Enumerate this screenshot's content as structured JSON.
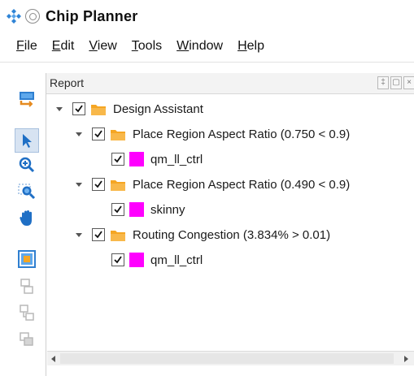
{
  "window": {
    "title": "Chip Planner"
  },
  "menu": [
    {
      "mnemonic": "F",
      "rest": "ile"
    },
    {
      "mnemonic": "E",
      "rest": "dit"
    },
    {
      "mnemonic": "V",
      "rest": "iew"
    },
    {
      "mnemonic": "T",
      "rest": "ools"
    },
    {
      "mnemonic": "W",
      "rest": "indow"
    },
    {
      "mnemonic": "H",
      "rest": "elp"
    }
  ],
  "toolbar": {
    "tools": [
      {
        "icon": "floorplan-icon"
      },
      {
        "icon": "selection-tool-icon"
      },
      {
        "icon": "zoom-in-icon"
      },
      {
        "icon": "zoom-area-icon"
      },
      {
        "icon": "hand-tool-icon"
      },
      {
        "icon": "region-tool-icon"
      },
      {
        "icon": "disabled-tool-icon"
      },
      {
        "icon": "disabled-tool-icon"
      },
      {
        "icon": "disabled-tool-icon"
      }
    ]
  },
  "panel": {
    "title": "Report",
    "tree": {
      "root": {
        "label": "Design Assistant",
        "checked": true,
        "expanded": true
      },
      "groups": [
        {
          "label": "Place Region Aspect Ratio (0.750 < 0.9)",
          "checked": true,
          "expanded": true,
          "child": "qm_ll_ctrl"
        },
        {
          "label": "Place Region Aspect Ratio (0.490 < 0.9)",
          "checked": true,
          "expanded": true,
          "child": "skinny"
        },
        {
          "label": "Routing Congestion (3.834% > 0.01)",
          "checked": true,
          "expanded": true,
          "child": "qm_ll_ctrl"
        }
      ]
    }
  },
  "colors": {
    "folder": "#f5a623",
    "swatch": "#ff00ff",
    "accent": "#1f6fc5",
    "logo": "#2f84d6"
  }
}
